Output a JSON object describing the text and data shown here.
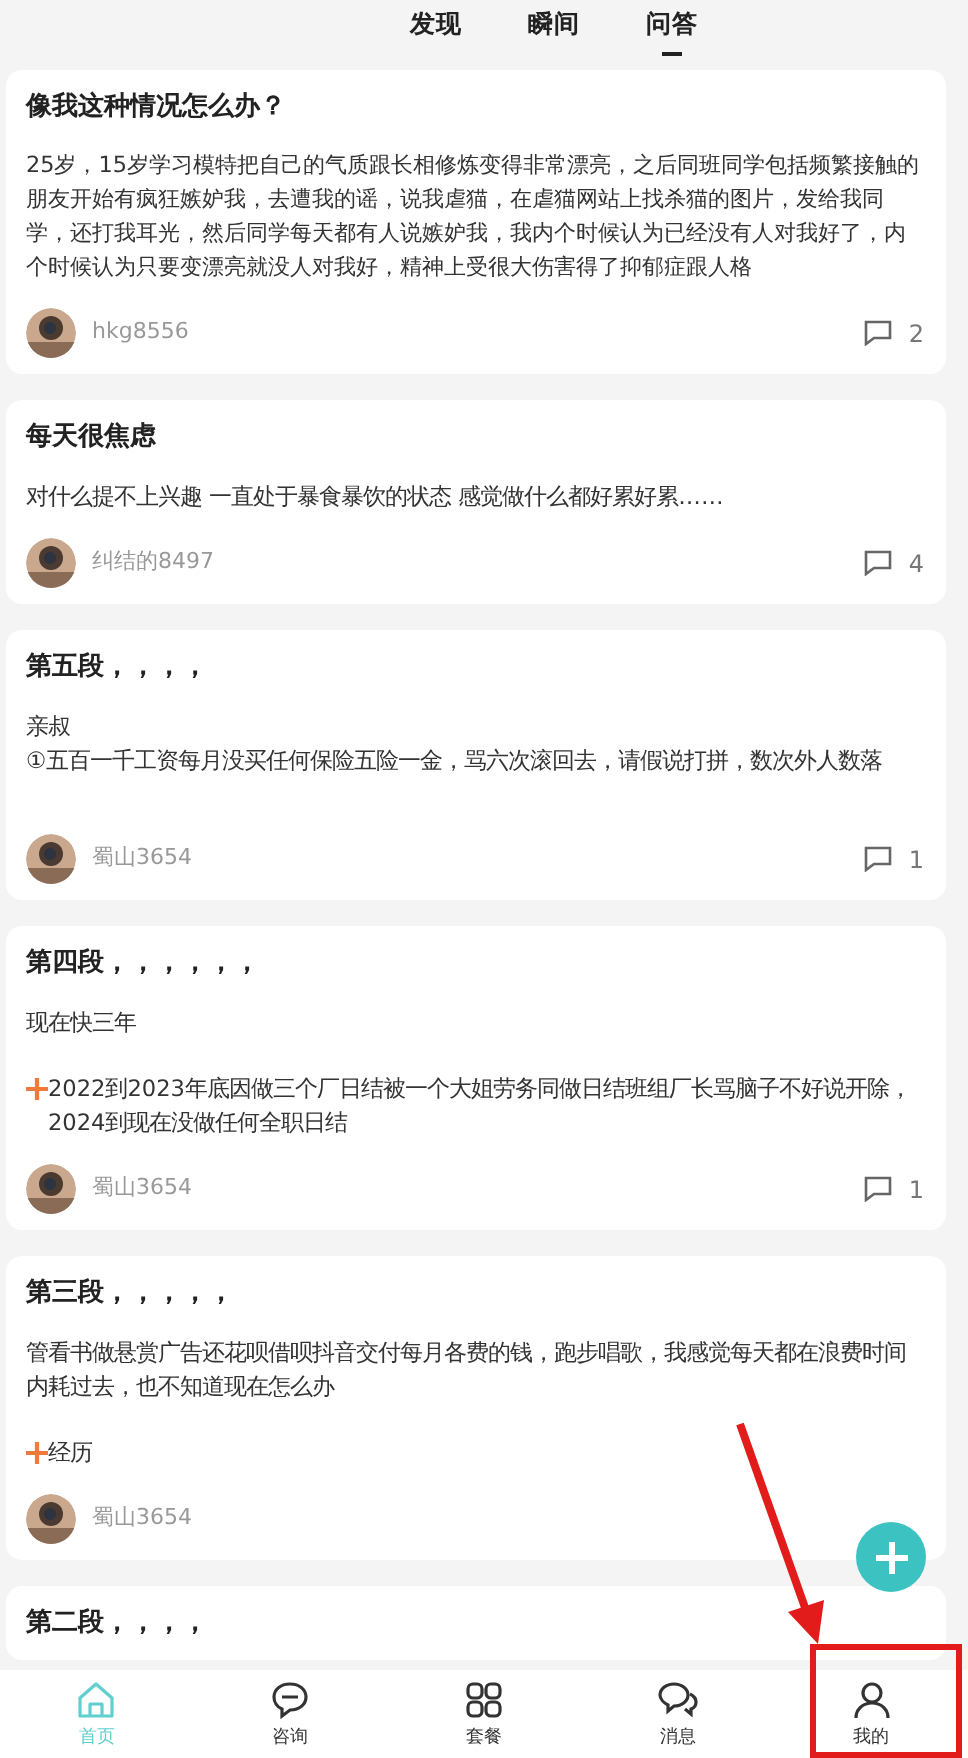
{
  "tabs": [
    {
      "label": "发现",
      "selected": false
    },
    {
      "label": "瞬间",
      "selected": false
    },
    {
      "label": "问答",
      "selected": true
    }
  ],
  "posts": [
    {
      "title": "像我这种情况怎么办？",
      "body": [
        {
          "kind": "text",
          "text": "25岁，15岁学习模特把自己的气质跟长相修炼变得非常漂亮，之后同班同学包括频繁接触的朋友开始有疯狂嫉妒我，去遭我的谣，说我虐猫，在虐猫网站上找杀猫的图片，发给我同学，还打我耳光，然后同学每天都有人说嫉妒我，我内个时候认为已经没有人对我好了，内个时候认为只要变漂亮就没人对我好，精神上受很大伤害得了抑郁症跟人格"
        }
      ],
      "author": "hkg8556",
      "comments": "2"
    },
    {
      "title": "每天很焦虑",
      "body": [
        {
          "kind": "text",
          "text": " 对什么提不上兴趣 一直处于暴食暴饮的状态  感觉做什么都好累好累……"
        }
      ],
      "author": "纠结的8497",
      "comments": "4"
    },
    {
      "title": "第五段，，，，",
      "body": [
        {
          "kind": "text",
          "text": "亲叔"
        },
        {
          "kind": "text",
          "text": "①五百一千工资每月没买任何保险五险一金，骂六次滚回去，请假说打拼，数次外人数落"
        },
        {
          "kind": "gap"
        }
      ],
      "author": "蜀山3654",
      "comments": "1"
    },
    {
      "title": "第四段，，，，，，",
      "body": [
        {
          "kind": "text",
          "text": "现在快三年"
        },
        {
          "kind": "gap"
        },
        {
          "kind": "plus",
          "text": "2022到2023年底因做三个厂日结被一个大姐劳务同做日结班组厂长骂脑子不好说开除，2024到现在没做任何全职日结"
        }
      ],
      "author": "蜀山3654",
      "comments": "1"
    },
    {
      "title": "第三段，，，，，",
      "body": [
        {
          "kind": "text",
          "text": "管看书做悬赏广告还花呗借呗抖音交付每月各费的钱，跑步唱歌，我感觉每天都在浪费时间内耗过去，也不知道现在怎么办"
        },
        {
          "kind": "gap"
        },
        {
          "kind": "plus",
          "text": "经历"
        }
      ],
      "author": "蜀山3654"
    },
    {
      "title": "第二段，，，，"
    }
  ],
  "nav": [
    {
      "label": "首页",
      "selected": true
    },
    {
      "label": "咨询",
      "selected": false
    },
    {
      "label": "套餐",
      "selected": false
    },
    {
      "label": "消息",
      "selected": false
    },
    {
      "label": "我的",
      "selected": false
    }
  ]
}
